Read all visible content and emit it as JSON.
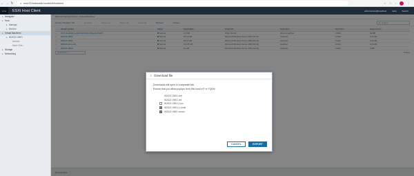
{
  "browser": {
    "url": "esxi-02.brainsclub.local/ui/#/host/vms"
  },
  "app": {
    "logo": "vmw",
    "title": "ESXi Host Client",
    "user": "administrator@localhost",
    "help": "Help",
    "search": "Search"
  },
  "sidebar": {
    "items": [
      {
        "label": "Navigator",
        "level": 0,
        "active": false
      },
      {
        "label": "Host",
        "level": 0,
        "active": false
      },
      {
        "label": "Manage",
        "level": 1,
        "active": false
      },
      {
        "label": "Monitor",
        "level": 1,
        "active": false
      },
      {
        "label": "Virtual Machines",
        "level": 0,
        "active": true
      },
      {
        "label": "W2K22-VM01",
        "level": 1,
        "active": false
      },
      {
        "label": "Monitor",
        "level": 2,
        "active": false
      },
      {
        "label": "More VMs...",
        "level": 2,
        "active": false
      },
      {
        "label": "Storage",
        "level": 0,
        "active": false
      },
      {
        "label": "Networking",
        "level": 0,
        "active": false
      }
    ]
  },
  "main": {
    "breadcrumb": "ESXi-02.brainsclub.local - Virtual Machines",
    "toolbar": {
      "create": "Create / Register VM",
      "console": "Console",
      "power_on": "Power on",
      "power_off": "Power off",
      "suspend": "Suspend",
      "refresh": "Refresh",
      "actions": "Actions",
      "search_placeholder": "Search"
    },
    "columns": {
      "vm": "Virtual machine",
      "status": "Status",
      "used": "Used space",
      "os": "Guest OS",
      "host": "Host name",
      "cpu": "Host CPU",
      "mem": "Host memory"
    },
    "rows": [
      {
        "vm": "vCLS-4ee0a31f-ed19-4fe8-8d4b-4fe9eebef7a970",
        "status": "Normal",
        "used": "2.3 GB",
        "os": "Other (32-bit)",
        "host": "photon-machine",
        "cpu": "0 MHz",
        "mem": "94 MB"
      },
      {
        "vm": "W2K22-VM01",
        "status": "Normal",
        "used": "66.13 GB",
        "os": "Microsoft Windows Server 2022 (64-bit)",
        "host": "Unknown",
        "cpu": "0 MHz",
        "mem": "0.23 GB"
      },
      {
        "vm": "W2K22-VM02",
        "status": "Normal",
        "used": "66.13 GB",
        "os": "Microsoft Windows Server 2022 (64-bit)",
        "host": "Unknown",
        "cpu": "0 MHz",
        "mem": "0.23 GB"
      },
      {
        "vm": "W2K22-test-vm01",
        "status": "Normal",
        "used": "102.05 GB",
        "os": "Microsoft Windows Server 2022 (64-bit)",
        "host": "localhost",
        "cpu": "0 MHz",
        "mem": "0.23 GB"
      },
      {
        "vm": "W2K22-VM03",
        "status": "Normal",
        "used": "15 GB",
        "os": "Microsoft Windows Server 2022 (64-bit)",
        "host": "Unknown",
        "cpu": "0 MHz",
        "mem": "0 MB"
      }
    ],
    "filter_placeholder": "Quick filters...",
    "items_count": "5 items",
    "bottom_panel": "Recent tasks"
  },
  "dialog": {
    "title": "Download file",
    "line1": "Downloads will open in a separate tab.",
    "line2": "Ensure that you allow popups from this host's IP or FQDN.",
    "files": [
      {
        "name": "W2K22-VM01.vmf",
        "checkbox": false,
        "checked": false
      },
      {
        "name": "W2K22-VM01.nvf",
        "checkbox": false,
        "checked": false
      },
      {
        "name": "W2K22-VM01-1.iso",
        "checkbox": true,
        "checked": false
      },
      {
        "name": "W2K22-VM01-1.vmdk",
        "checkbox": true,
        "checked": true
      },
      {
        "name": "W2K22-VM01.nvram",
        "checkbox": true,
        "checked": true
      }
    ],
    "cancel": "CANCEL",
    "export": "EXPORT"
  },
  "colors": {
    "accent": "#1a6fa0",
    "header_bg": "#1f2b38",
    "sidebar_bg": "#e9edf1",
    "status_normal": "#3a8a3a"
  }
}
